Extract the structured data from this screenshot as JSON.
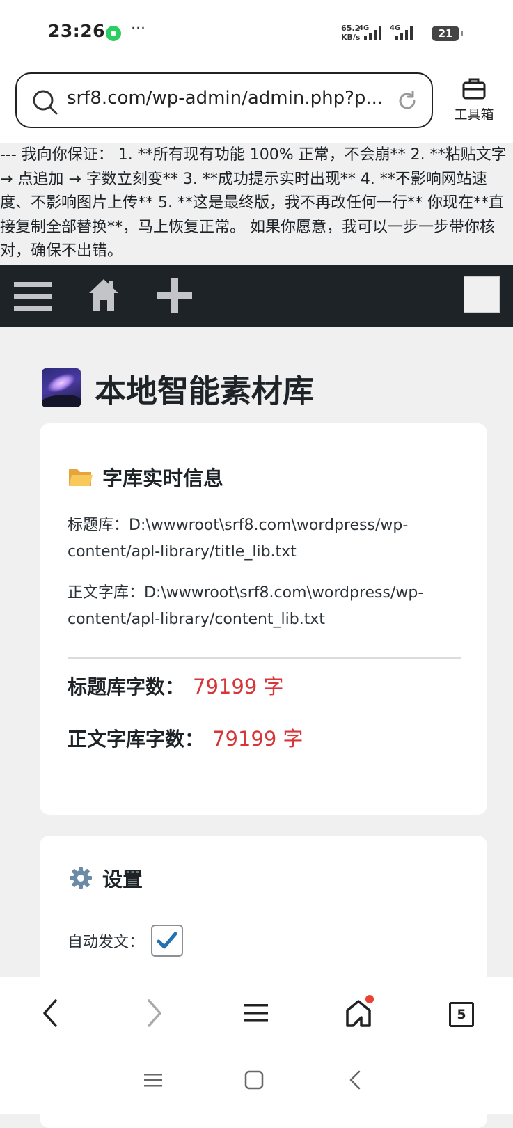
{
  "status_bar": {
    "time": "23:26",
    "more": "···",
    "net_speed_value": "65.2",
    "net_speed_unit": "KB/s",
    "net_type_1": "4G",
    "net_type_2": "4G",
    "battery": "21"
  },
  "browser": {
    "url": "srf8.com/wp-admin/admin.php?p...",
    "toolbox_label": "工具箱"
  },
  "notice": {
    "text": "--- 我向你保证： 1. **所有现有功能 100% 正常，不会崩** 2. **粘贴文字 → 点追加 → 字数立刻变** 3. **成功提示实时出现** 4. **不影响网站速度、不影响图片上传** 5. **这是最终版，我不再改任何一行** 你现在**直接复制全部替换**，马上恢复正常。 如果你愿意，我可以一步一步带你核对，确保不出错。"
  },
  "page": {
    "title": "本地智能素材库"
  },
  "library_card": {
    "heading": "字库实时信息",
    "title_lib_label": "标题库：",
    "title_lib_path": "D:\\wwwroot\\srf8.com\\wordpress/wp-content/apl-library/title_lib.txt",
    "content_lib_label": "正文字库：",
    "content_lib_path": "D:\\wwwroot\\srf8.com\\wordpress/wp-content/apl-library/content_lib.txt",
    "title_count_label": "标题库字数：",
    "title_count_value": "79199 字",
    "content_count_label": "正文字库字数：",
    "content_count_value": "79199 字"
  },
  "settings_card": {
    "heading": "设置",
    "auto_post_label": "自动发文：",
    "auto_post_checked": true
  },
  "bottom_nav": {
    "tabs_count": "5"
  }
}
